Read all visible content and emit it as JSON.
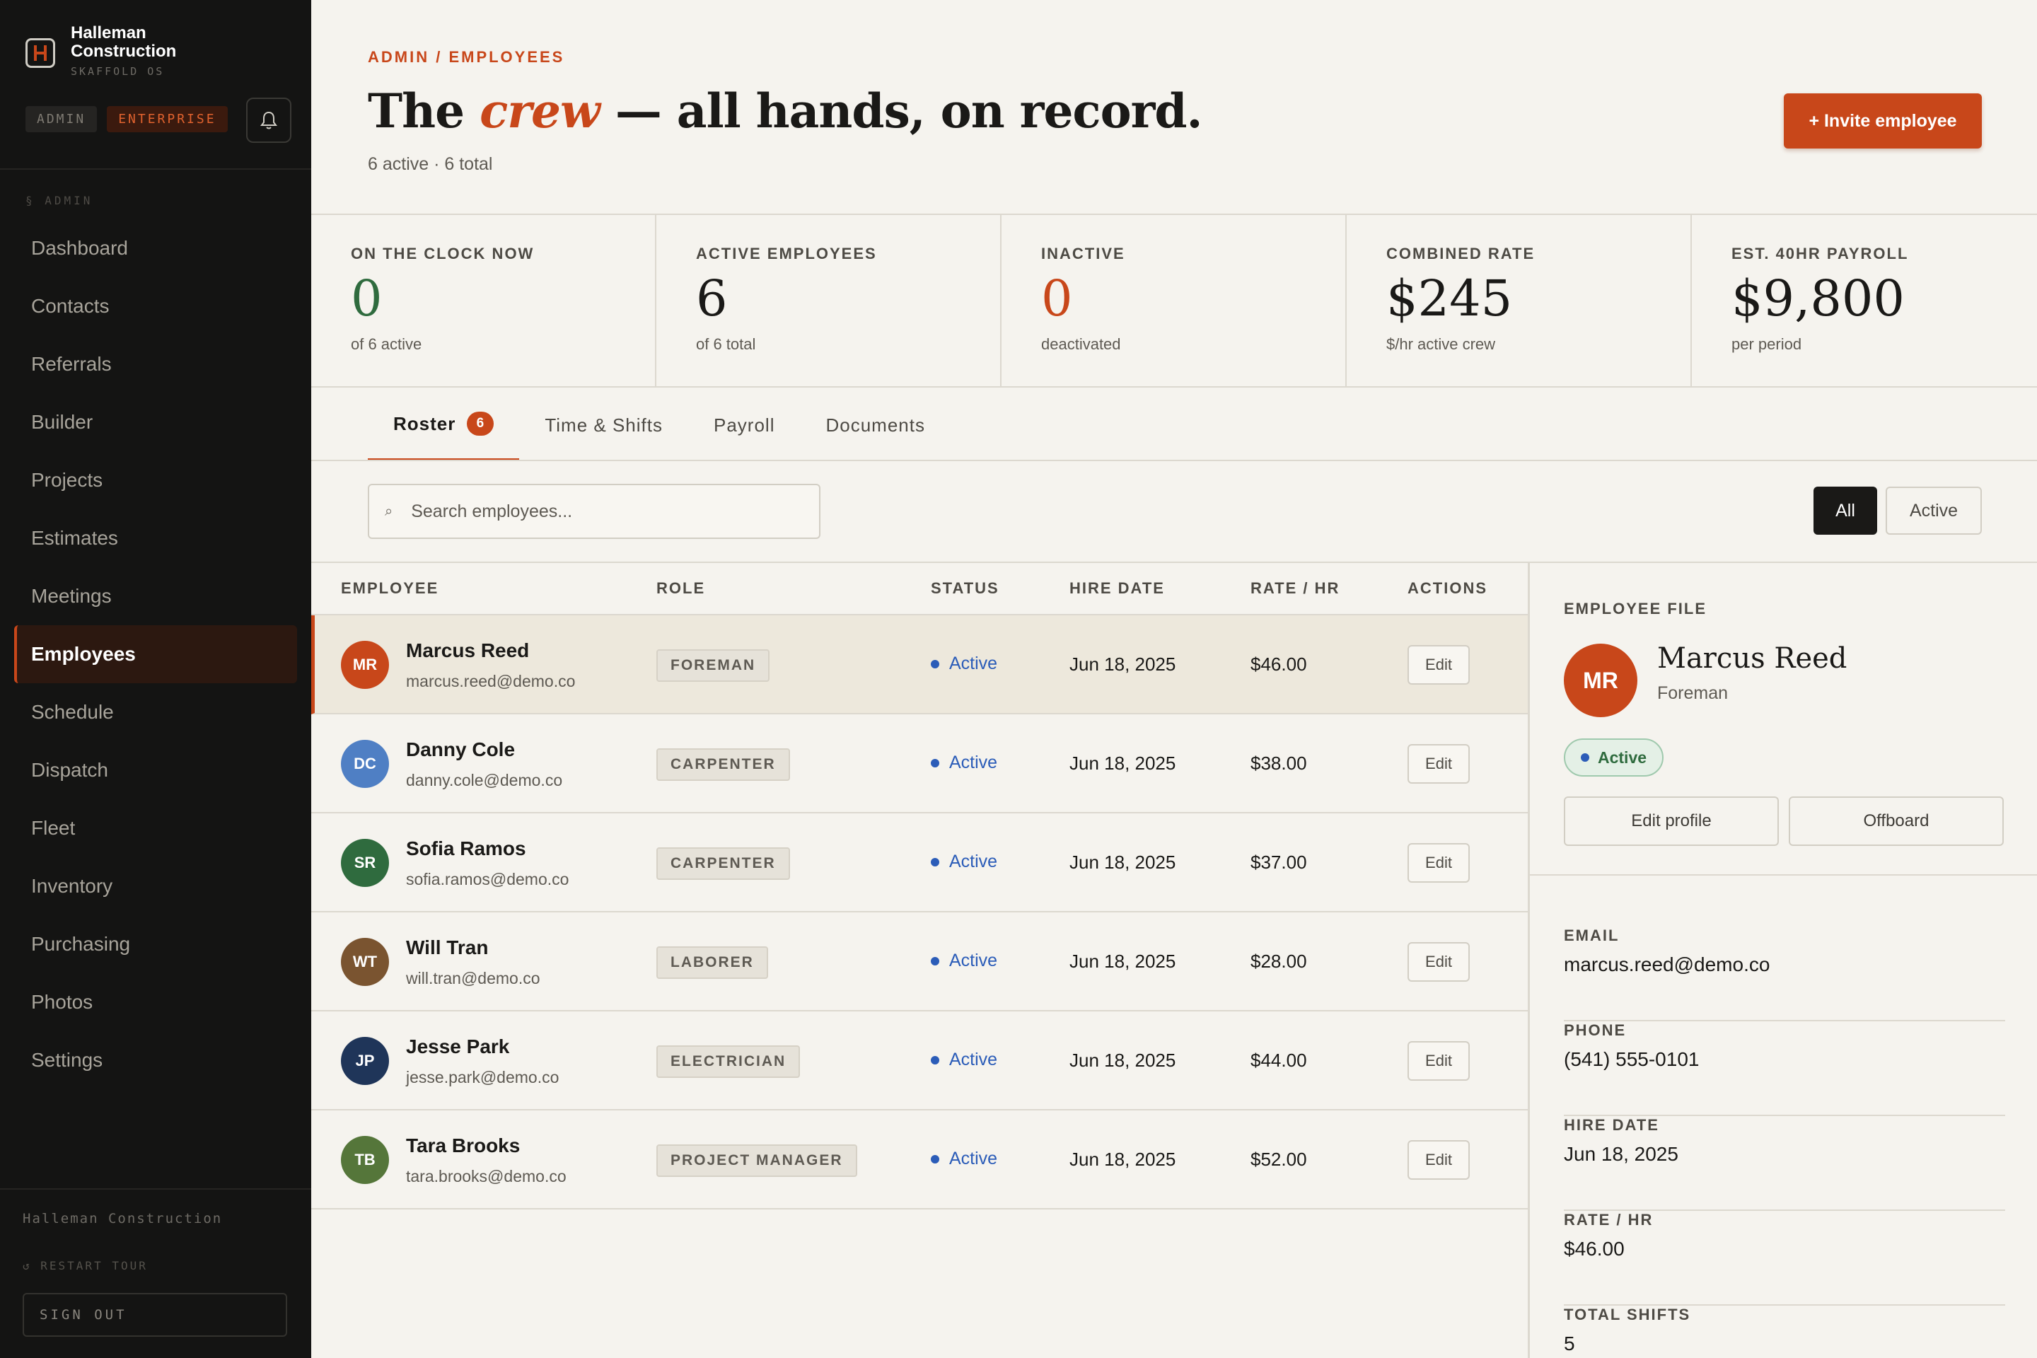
{
  "sidebar": {
    "brand_name_line1": "Halleman",
    "brand_name_line2": "Construction",
    "brand_sub": "SKAFFOLD OS",
    "tag_admin": "ADMIN",
    "tag_enterprise": "ENTERPRISE",
    "section_label": "§ ADMIN",
    "items": [
      {
        "label": "Dashboard"
      },
      {
        "label": "Contacts"
      },
      {
        "label": "Referrals"
      },
      {
        "label": "Builder"
      },
      {
        "label": "Projects"
      },
      {
        "label": "Estimates"
      },
      {
        "label": "Meetings"
      },
      {
        "label": "Employees",
        "active": true
      },
      {
        "label": "Schedule"
      },
      {
        "label": "Dispatch"
      },
      {
        "label": "Fleet"
      },
      {
        "label": "Inventory"
      },
      {
        "label": "Purchasing"
      },
      {
        "label": "Photos"
      },
      {
        "label": "Settings"
      }
    ],
    "company": "Halleman Construction",
    "restart_tour": "↺ RESTART TOUR",
    "sign_out": "SIGN OUT"
  },
  "header": {
    "breadcrumb": "ADMIN / EMPLOYEES",
    "title_pre": "The ",
    "title_em": "crew",
    "title_post": " — all hands, on record.",
    "subtitle": "6 active · 6 total",
    "invite_label": "+ Invite employee"
  },
  "stats": [
    {
      "label": "ON THE CLOCK NOW",
      "value": "0",
      "foot": "of 6 active",
      "tone": "green"
    },
    {
      "label": "ACTIVE EMPLOYEES",
      "value": "6",
      "foot": "of 6 total",
      "tone": ""
    },
    {
      "label": "INACTIVE",
      "value": "0",
      "foot": "deactivated",
      "tone": "orange"
    },
    {
      "label": "COMBINED RATE",
      "value": "$245",
      "foot": "$/hr active crew",
      "tone": ""
    },
    {
      "label": "EST. 40HR PAYROLL",
      "value": "$9,800",
      "foot": "per period",
      "tone": ""
    }
  ],
  "tabs": [
    {
      "label": "Roster",
      "badge": "6",
      "active": true
    },
    {
      "label": "Time & Shifts"
    },
    {
      "label": "Payroll"
    },
    {
      "label": "Documents"
    }
  ],
  "search": {
    "placeholder": "Search employees..."
  },
  "filters": {
    "all": "All",
    "active": "Active"
  },
  "table": {
    "headers": {
      "employee": "EMPLOYEE",
      "role": "ROLE",
      "status": "STATUS",
      "hire": "HIRE DATE",
      "rate": "RATE / HR",
      "actions": "ACTIONS"
    },
    "edit_label": "Edit",
    "rows": [
      {
        "initials": "MR",
        "color": "#c8471a",
        "name": "Marcus Reed",
        "email": "marcus.reed@demo.co",
        "role": "FOREMAN",
        "status": "Active",
        "hire": "Jun 18, 2025",
        "rate": "$46.00",
        "selected": true
      },
      {
        "initials": "DC",
        "color": "#4f7fc4",
        "name": "Danny Cole",
        "email": "danny.cole@demo.co",
        "role": "CARPENTER",
        "status": "Active",
        "hire": "Jun 18, 2025",
        "rate": "$38.00"
      },
      {
        "initials": "SR",
        "color": "#2f6b3e",
        "name": "Sofia Ramos",
        "email": "sofia.ramos@demo.co",
        "role": "CARPENTER",
        "status": "Active",
        "hire": "Jun 18, 2025",
        "rate": "$37.00"
      },
      {
        "initials": "WT",
        "color": "#7a5430",
        "name": "Will Tran",
        "email": "will.tran@demo.co",
        "role": "LABORER",
        "status": "Active",
        "hire": "Jun 18, 2025",
        "rate": "$28.00"
      },
      {
        "initials": "JP",
        "color": "#1f3559",
        "name": "Jesse Park",
        "email": "jesse.park@demo.co",
        "role": "ELECTRICIAN",
        "status": "Active",
        "hire": "Jun 18, 2025",
        "rate": "$44.00"
      },
      {
        "initials": "TB",
        "color": "#55763a",
        "name": "Tara Brooks",
        "email": "tara.brooks@demo.co",
        "role": "PROJECT MANAGER",
        "status": "Active",
        "hire": "Jun 18, 2025",
        "rate": "$52.00"
      }
    ]
  },
  "panel": {
    "label": "EMPLOYEE FILE",
    "initials": "MR",
    "name": "Marcus Reed",
    "role": "Foreman",
    "status": "Active",
    "edit_profile": "Edit profile",
    "offboard": "Offboard",
    "fields": [
      {
        "label": "EMAIL",
        "value": "marcus.reed@demo.co"
      },
      {
        "label": "PHONE",
        "value": "(541) 555-0101"
      },
      {
        "label": "HIRE DATE",
        "value": "Jun 18, 2025"
      },
      {
        "label": "RATE / HR",
        "value": "$46.00"
      },
      {
        "label": "TOTAL SHIFTS",
        "value": "5"
      }
    ]
  },
  "colors": {
    "accent": "#c8471a",
    "status_blue": "#2b5cb8",
    "green": "#2f6b3e"
  }
}
